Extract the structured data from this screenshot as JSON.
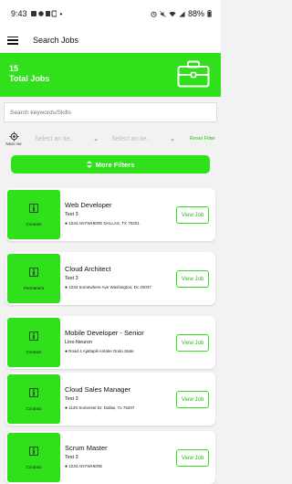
{
  "status": {
    "time": "9:43",
    "battery": "88%"
  },
  "appbar": {
    "title": "Search Jobs"
  },
  "banner": {
    "count": "15",
    "label": "Total Jobs"
  },
  "search": {
    "placeholder": "Search keywords/Skills"
  },
  "filters": {
    "near_me_label": "Near me",
    "city_placeholder_1": "Select an ite..",
    "city_placeholder_2": "Select an ite..",
    "reset_label": "Reset Filter"
  },
  "more_filters": {
    "label": "More Filters"
  },
  "jobs": [
    {
      "type": "Contract",
      "title": "Web Developer",
      "company": "Test 3",
      "address": "1234 ANYWHERE DALLAS, TX 75201",
      "button": "View Job"
    },
    {
      "type": "Permanent",
      "title": "Cloud Architect",
      "company": "Test 3",
      "address": "1234 Somewhere Ave Washington, Dc 20037",
      "button": "View Job"
    },
    {
      "type": "Contract",
      "title": "Mobile Developer - Senior",
      "company": "Linx-Neuron",
      "address": "Road 4 Ajaltapili Airtake Ondo State",
      "button": "View Job"
    },
    {
      "type": "Contract",
      "title": "Cloud Sales Manager",
      "company": "Test 3",
      "address": "1120 Somerset Dr, Dallas, Tx 75207",
      "button": "View Job"
    },
    {
      "type": "Contract",
      "title": "Scrum Master",
      "company": "Test 3",
      "address": "1234 ANYWHERE",
      "button": "View Job"
    }
  ],
  "colors": {
    "accent": "#2fe01a",
    "accent_text": "#2fb81a"
  }
}
